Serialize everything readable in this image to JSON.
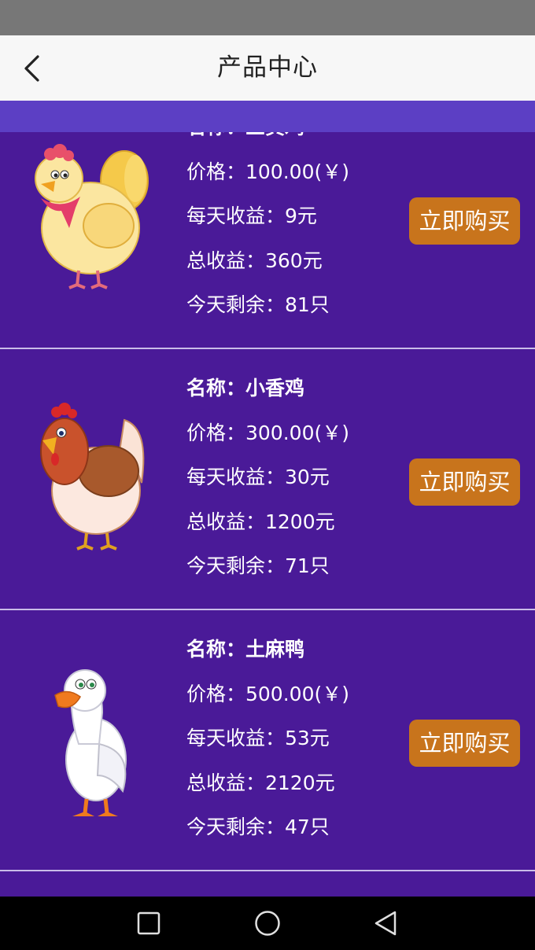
{
  "header": {
    "title": "产品中心"
  },
  "products": [
    {
      "name": "名称：三黄鸡",
      "price": "价格：100.00(￥)",
      "daily": "每天收益：9元",
      "total": "总收益：360元",
      "remain": "今天剩余：81只",
      "buy": "立即购买",
      "image": "yellow-hen"
    },
    {
      "name": "名称：小香鸡",
      "price": "价格：300.00(￥)",
      "daily": "每天收益：30元",
      "total": "总收益：1200元",
      "remain": "今天剩余：71只",
      "buy": "立即购买",
      "image": "brown-hen"
    },
    {
      "name": "名称：土麻鸭",
      "price": "价格：500.00(￥)",
      "daily": "每天收益：53元",
      "total": "总收益：2120元",
      "remain": "今天剩余：47只",
      "buy": "立即购买",
      "image": "white-duck"
    }
  ],
  "nav": {
    "icons": [
      "recent-apps-icon",
      "home-icon",
      "back-icon"
    ]
  },
  "colors": {
    "background": "#4a1a98",
    "button": "#c8741c",
    "header": "#f7f7f7"
  }
}
